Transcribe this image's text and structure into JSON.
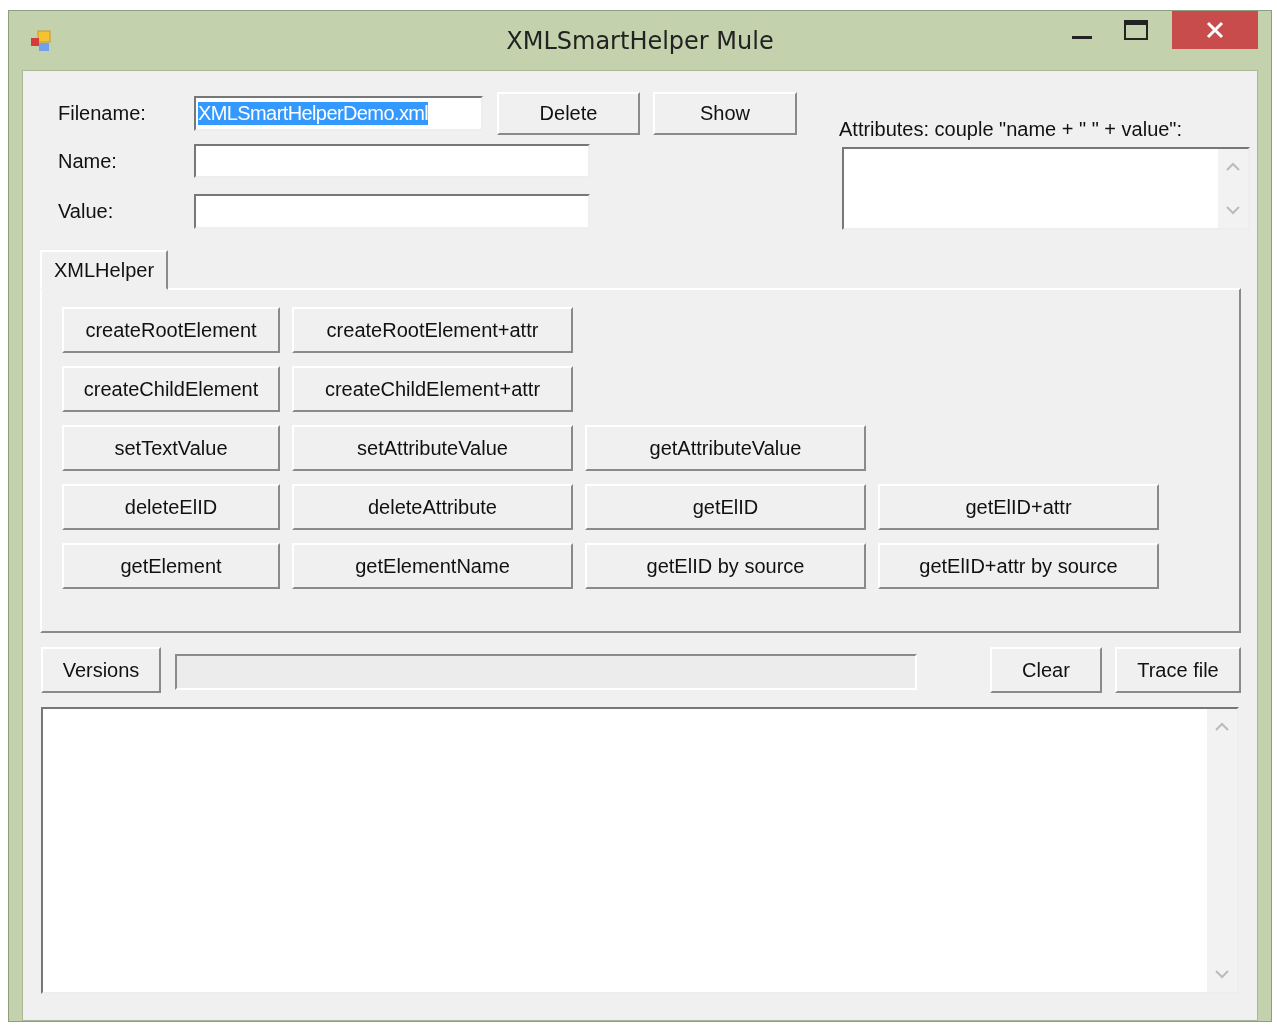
{
  "window": {
    "title": "XMLSmartHelper Mule"
  },
  "fields": [
    {
      "label": "Filename:",
      "value": "XMLSmartHelperDemo.xml",
      "text_selected": true
    },
    {
      "label": "Name:"
    },
    {
      "label": "Value:"
    }
  ],
  "file_buttons": [
    "Delete",
    "Show"
  ],
  "attributes": {
    "label": "Attributes: couple \"name + \" \" + value\":"
  },
  "tabs": [
    {
      "label": "XMLHelper",
      "selected": true
    }
  ],
  "button_rows": [
    [
      "createRootElement",
      "createRootElement+attr"
    ],
    [
      "createChildElement",
      "createChildElement+attr"
    ],
    [
      "setTextValue",
      "setAttributeValue",
      "getAttributeValue"
    ],
    [
      "deleteElID",
      "deleteAttribute",
      "getElID",
      "getElID+attr"
    ],
    [
      "getElement",
      "getElementName",
      "getElID by source",
      "getElID+attr by source"
    ]
  ],
  "versions_button": "Versions",
  "progress": {
    "level": 0
  },
  "bottom_buttons": [
    "Clear",
    "Trace file"
  ]
}
